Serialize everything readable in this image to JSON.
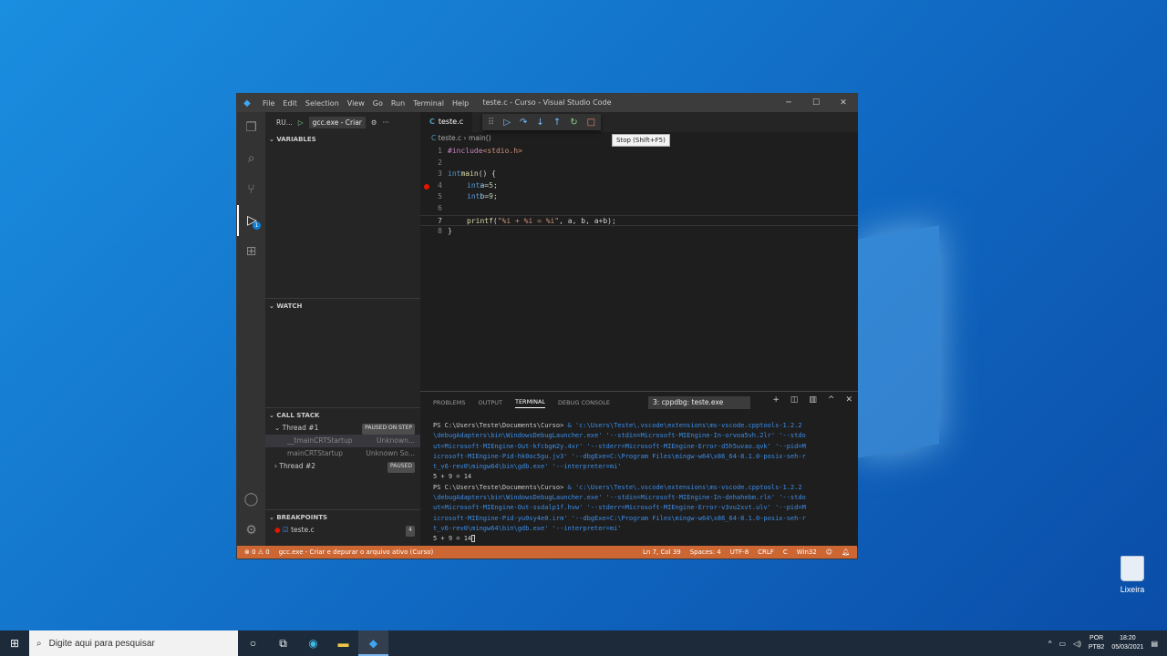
{
  "window": {
    "title": "teste.c - Curso - Visual Studio Code",
    "menu": [
      "File",
      "Edit",
      "Selection",
      "View",
      "Go",
      "Run",
      "Terminal",
      "Help"
    ]
  },
  "sidebar": {
    "run_label": "RU...",
    "config": "gcc.exe - Criar",
    "variables_title": "VARIABLES",
    "watch_title": "WATCH",
    "callstack_title": "CALL STACK",
    "threads": [
      {
        "name": "Thread #1",
        "status": "PAUSED ON STEP"
      },
      {
        "name": "Thread #2",
        "status": "PAUSED"
      }
    ],
    "frames": [
      {
        "name": "__tmainCRTStartup",
        "source": "Unknown..."
      },
      {
        "name": "mainCRTStartup",
        "source": "Unknown So..."
      }
    ],
    "breakpoints_title": "BREAKPOINTS",
    "breakpoint_file": "teste.c",
    "breakpoint_count": "4",
    "debug_badge": "1"
  },
  "editor": {
    "tab": "teste.c",
    "breadcrumb_file": "teste.c",
    "breadcrumb_symbol": "main()",
    "tooltip": "Stop (Shift+F5)",
    "line_numbers": [
      "1",
      "2",
      "3",
      "4",
      "5",
      "6",
      "7",
      "8"
    ],
    "lines": {
      "l1_pp": "#include",
      "l1_str": " <stdio.h>",
      "l3_kw": "int",
      "l3_fn": " main",
      "l3_rest": "() {",
      "l4_kw": "int",
      "l4_id": " a",
      "l4_eq": " = ",
      "l4_num": "5",
      "l4_end": ";",
      "l5_kw": "int",
      "l5_id": " b",
      "l5_eq": " = ",
      "l5_num": "9",
      "l5_end": ";",
      "l7_fn": "printf",
      "l7_open": "(",
      "l7_str": "\"%i + %i = %i\"",
      "l7_rest": ", a, b, a+b);",
      "l8": "}"
    }
  },
  "panel": {
    "tabs": [
      "PROBLEMS",
      "OUTPUT",
      "TERMINAL",
      "DEBUG CONSOLE"
    ],
    "terminal_select": "3: cppdbg: teste.exe",
    "terminal": {
      "prompt1": "PS C:\\Users\\Teste\\Documents\\Curso>",
      "cmd1a": " & 'c:\\Users\\Teste\\.vscode\\extensions\\ms-vscode.cpptools-1.2.2",
      "cmd1b": "\\debugAdapters\\bin\\WindowsDebugLauncher.exe' '--stdin=Microsoft-MIEngine-In-orvoa5vh.2lr' '--stdo",
      "cmd1c": "ut=Microsoft-MIEngine-Out-kfcbgm2y.4xr' '--stderr=Microsoft-MIEngine-Error-d5h5uvao.qvk' '--pid=M",
      "cmd1d": "icrosoft-MIEngine-Pid-hk0oc5gu.jv3' '--dbgExe=C:\\Program Files\\mingw-w64\\x86_64-8.1.0-posix-seh-r",
      "cmd1e": "t_v6-rev0\\mingw64\\bin\\gdb.exe' '--interpreter=mi'",
      "out1": "5 + 9 = 14",
      "prompt2": "PS C:\\Users\\Teste\\Documents\\Curso>",
      "cmd2a": " & 'c:\\Users\\Teste\\.vscode\\extensions\\ms-vscode.cpptools-1.2.2",
      "cmd2b": "\\debugAdapters\\bin\\WindowsDebugLauncher.exe' '--stdin=Microsoft-MIEngine-In-dnhahebm.rln' '--stdo",
      "cmd2c": "ut=Microsoft-MIEngine-Out-ssdalp1f.hvw' '--stderr=Microsoft-MIEngine-Error-v3vu2xvt.ulv' '--pid=M",
      "cmd2d": "icrosoft-MIEngine-Pid-yu0sy4e0.irm' '--dbgExe=C:\\Program Files\\mingw-w64\\x86_64-8.1.0-posix-seh-r",
      "cmd2e": "t_v6-rev0\\mingw64\\bin\\gdb.exe' '--interpreter=mi'",
      "out2": "5 + 9 = 14"
    }
  },
  "status": {
    "problems": "⊗ 0 ⚠ 0",
    "launch": "gcc.exe - Criar e depurar o arquivo ativo (Curso)",
    "position": "Ln 7, Col 39",
    "spaces": "Spaces: 4",
    "encoding": "UTF-8",
    "eol": "CRLF",
    "language": "C",
    "platform": "Win32"
  },
  "desktop": {
    "recycle_bin": "Lixeira"
  },
  "taskbar": {
    "search_placeholder": "Digite aqui para pesquisar",
    "lang1": "POR",
    "lang2": "PTB2",
    "time": "18:20",
    "date": "05/03/2021"
  }
}
